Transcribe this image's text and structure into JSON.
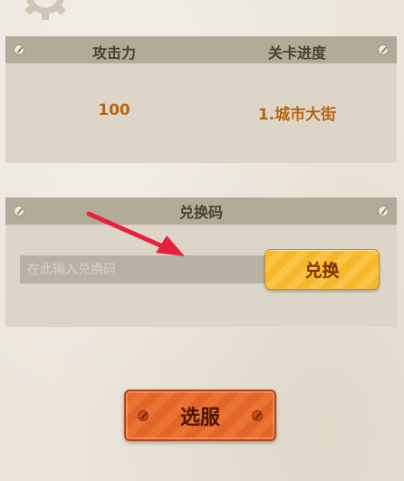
{
  "stats": {
    "headers": [
      "攻击力",
      "关卡进度"
    ],
    "values": [
      "100",
      "1.城市大街"
    ]
  },
  "redeem": {
    "title": "兑换码",
    "placeholder": "在此输入兑换码",
    "button_label": "兑换"
  },
  "server_button_label": "选服",
  "colors": {
    "panel_header": "#b3aa99",
    "value_orange": "#b7640e",
    "redeem_button": "#f7b62c",
    "server_button": "#e4652a",
    "arrow": "#e8203a"
  },
  "icons": [
    "gear-icon",
    "screw-icon",
    "arrow-annotation"
  ]
}
